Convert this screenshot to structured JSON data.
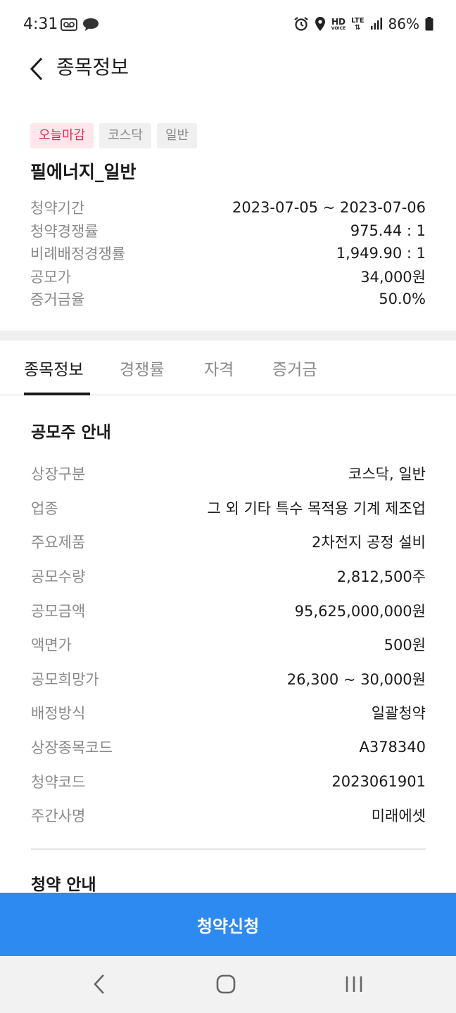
{
  "status_bar": {
    "time": "4:31",
    "battery": "86%",
    "hd_top": "HD",
    "hd_bottom": "VOICE",
    "lte": "LTE"
  },
  "header": {
    "title": "종목정보"
  },
  "summary": {
    "tags": [
      "오늘마감",
      "코스닥",
      "일반"
    ],
    "name": "필에너지_일반",
    "rows": [
      {
        "label": "청약기간",
        "value": "2023-07-05 ~ 2023-07-06"
      },
      {
        "label": "청약경쟁률",
        "value": "975.44 : 1"
      },
      {
        "label": "비례배정경쟁률",
        "value": "1,949.90 : 1"
      },
      {
        "label": "공모가",
        "value": "34,000원"
      },
      {
        "label": "증거금율",
        "value": "50.0%"
      }
    ]
  },
  "tabs": [
    "종목정보",
    "경쟁률",
    "자격",
    "증거금"
  ],
  "offering": {
    "title": "공모주 안내",
    "rows": [
      {
        "label": "상장구분",
        "value": "코스닥, 일반"
      },
      {
        "label": "업종",
        "value": "그 외 기타 특수 목적용 기계 제조업"
      },
      {
        "label": "주요제품",
        "value": "2차전지 공정 설비"
      },
      {
        "label": "공모수량",
        "value": "2,812,500주"
      },
      {
        "label": "공모금액",
        "value": "95,625,000,000원"
      },
      {
        "label": "액면가",
        "value": "500원"
      },
      {
        "label": "공모희망가",
        "value": "26,300 ~ 30,000원"
      },
      {
        "label": "배정방식",
        "value": "일괄청약"
      },
      {
        "label": "상장종목코드",
        "value": "A378340"
      },
      {
        "label": "청약코드",
        "value": "2023061901"
      },
      {
        "label": "주간사명",
        "value": "미래에셋"
      }
    ]
  },
  "subscription": {
    "title": "청약 안내"
  },
  "cta": {
    "label": "청약신청"
  },
  "colors": {
    "accent": "#2d8af0",
    "deadline_tag_bg": "#fde7ec",
    "deadline_tag_text": "#d5325a"
  }
}
